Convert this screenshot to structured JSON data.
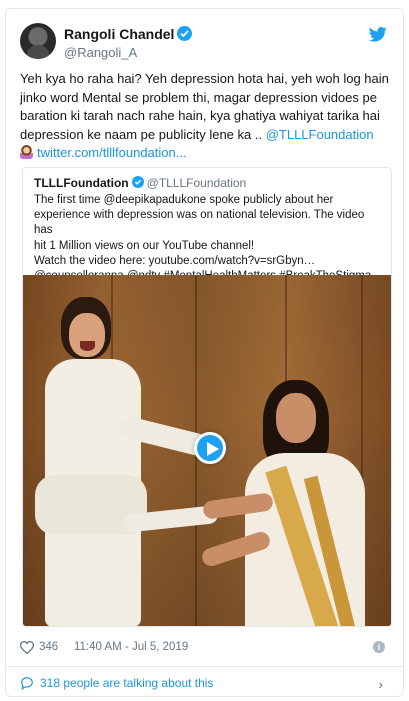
{
  "author": {
    "display_name": "Rangoli Chandel",
    "handle": "@Rangoli_A"
  },
  "tweet": {
    "text": "Yeh kya ho raha hai? Yeh depression hota hai, yeh woh log hain jinko word Mental se problem thi, magar depression vidoes pe baration ki tarah nach rahe hain, kya ghatiya wahiyat tarika hai depression ke naam pe publicity lene ka .. ",
    "mention": "@TLLLFoundation",
    "link": "twitter.com/tlllfoundation..."
  },
  "quoted": {
    "display_name": "TLLLFoundation",
    "handle": "@TLLLFoundation",
    "line1": "The first time @deepikapadukone spoke publicly about her",
    "line2": "experience with depression was on national television. The video has",
    "line3": "hit 1 Million views on our YouTube channel!",
    "line4": "Watch the video here: youtube.com/watch?v=srGbyn…",
    "line5": "@counselloranna @ndtv #MentalHealthMatters #BreakTheStigma"
  },
  "footer": {
    "likes": "346",
    "timestamp": "11:40 AM - Jul 5, 2019",
    "info": "i"
  },
  "talking": {
    "text": "318 people are talking about this"
  },
  "icons": {
    "brand": "twitter-bird-icon",
    "verified": "verified-badge-icon",
    "like": "heart-icon",
    "info": "info-icon",
    "conversation": "speech-bubble-icon",
    "more": "chevron-right-icon",
    "play": "play-icon"
  },
  "colors": {
    "accent": "#1da1f2",
    "link": "#1b95e0",
    "muted": "#657786",
    "border": "#e1e8ed"
  }
}
